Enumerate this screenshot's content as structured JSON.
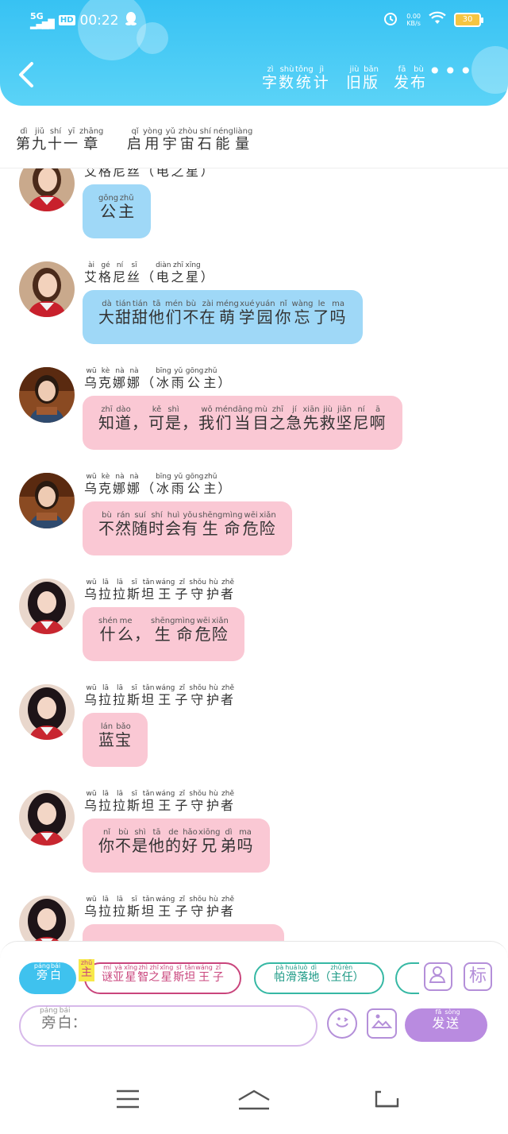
{
  "status_bar": {
    "signal": "5G",
    "hd": "HD",
    "time": "00:22",
    "net_speed_top": "0.00",
    "net_speed_bottom": "KB/s",
    "battery": "30"
  },
  "header": {
    "buttons": [
      {
        "text": "字数统计",
        "pinyin": [
          "zì",
          "shù",
          "tǒng",
          "jì"
        ]
      },
      {
        "text": "旧版",
        "pinyin": [
          "jiù",
          "bǎn"
        ]
      },
      {
        "text": "发布",
        "pinyin": [
          "fā",
          "bù"
        ]
      }
    ],
    "more": "•••"
  },
  "chapter": {
    "text": "第九十一章",
    "pinyin": [
      "dì",
      "jiǔ",
      "shí",
      "yī",
      "zhāng"
    ],
    "title": "启用宇宙石能量",
    "title_pinyin": [
      "qǐ",
      "yòng",
      "yǔ",
      "zhòu",
      "shí",
      "néng",
      "liàng"
    ]
  },
  "messages": [
    {
      "speaker": "艾格尼丝（电之星）",
      "speaker_pinyin": [
        "ài",
        "gé",
        "ní",
        "sī",
        "",
        "diàn",
        "zhī",
        "xīng",
        ""
      ],
      "text": "公主",
      "pinyin": [
        "gōng",
        "zhǔ"
      ],
      "color": "blue",
      "avatar": "agnes"
    },
    {
      "speaker": "艾格尼丝（电之星）",
      "speaker_pinyin": [
        "ài",
        "gé",
        "ní",
        "sī",
        "",
        "diàn",
        "zhī",
        "xīng",
        ""
      ],
      "text": "大甜甜他们不在萌学园你忘了吗",
      "pinyin": [
        "dà",
        "tián",
        "tián",
        "tā",
        "mén",
        "bù",
        "zài",
        "méng",
        "xué",
        "yuán",
        "nǐ",
        "wàng",
        "le",
        "ma"
      ],
      "color": "blue",
      "avatar": "agnes"
    },
    {
      "speaker": "乌克娜娜（冰雨公主）",
      "speaker_pinyin": [
        "wū",
        "kè",
        "nà",
        "nà",
        "",
        "bīng",
        "yǔ",
        "gōng",
        "zhǔ",
        ""
      ],
      "text": "知道，可是，我们当目之急先救坚尼啊",
      "pinyin": [
        "zhī",
        "dào",
        "",
        "kě",
        "shì",
        "",
        "wǒ",
        "mén",
        "dāng",
        "mù",
        "zhī",
        "jí",
        "xiān",
        "jiù",
        "jiān",
        "ní",
        "ā"
      ],
      "color": "pink",
      "avatar": "ukenana"
    },
    {
      "speaker": "乌克娜娜（冰雨公主）",
      "speaker_pinyin": [
        "wū",
        "kè",
        "nà",
        "nà",
        "",
        "bīng",
        "yǔ",
        "gōng",
        "zhǔ",
        ""
      ],
      "text": "不然随时会有生命危险",
      "pinyin": [
        "bù",
        "rán",
        "suí",
        "shí",
        "huì",
        "yǒu",
        "shēng",
        "mìng",
        "wēi",
        "xiǎn"
      ],
      "color": "pink",
      "avatar": "ukenana"
    },
    {
      "speaker": "乌拉拉斯坦王子守护者",
      "speaker_pinyin": [
        "wū",
        "lā",
        "lā",
        "sī",
        "tǎn",
        "wáng",
        "zǐ",
        "shǒu",
        "hù",
        "zhě"
      ],
      "text": "什么，生命危险",
      "pinyin": [
        "shén",
        "me",
        "",
        "shēng",
        "mìng",
        "wēi",
        "xiǎn"
      ],
      "color": "pink",
      "avatar": "urala"
    },
    {
      "speaker": "乌拉拉斯坦王子守护者",
      "speaker_pinyin": [
        "wū",
        "lā",
        "lā",
        "sī",
        "tǎn",
        "wáng",
        "zǐ",
        "shǒu",
        "hù",
        "zhě"
      ],
      "text": "蓝宝",
      "pinyin": [
        "lán",
        "bǎo"
      ],
      "color": "pink",
      "avatar": "urala"
    },
    {
      "speaker": "乌拉拉斯坦王子守护者",
      "speaker_pinyin": [
        "wū",
        "lā",
        "lā",
        "sī",
        "tǎn",
        "wáng",
        "zǐ",
        "shǒu",
        "hù",
        "zhě"
      ],
      "text": "你不是他的好兄弟吗",
      "pinyin": [
        "nǐ",
        "bù",
        "shì",
        "tā",
        "de",
        "hǎo",
        "xiōng",
        "dì",
        "ma"
      ],
      "color": "pink",
      "avatar": "urala"
    },
    {
      "speaker": "乌拉拉斯坦王子守护者",
      "speaker_pinyin": [
        "wū",
        "lā",
        "lā",
        "sī",
        "tǎn",
        "wáng",
        "zǐ",
        "shǒu",
        "hù",
        "zhě"
      ],
      "text": "",
      "pinyin": [],
      "color": "pink",
      "avatar": "urala"
    }
  ],
  "toolbar": {
    "narrator_chip": {
      "text": "旁白",
      "pinyin": [
        "páng",
        "bái"
      ]
    },
    "main_badge": {
      "text": "主",
      "pinyin": [
        "zhǔ"
      ]
    },
    "char_chip_1": {
      "text": "谜亚星智之星斯坦王子",
      "pinyin": [
        "mí",
        "yà",
        "xīng",
        "zhì",
        "zhī",
        "xīng",
        "sī",
        "tǎn",
        "wáng",
        "zǐ"
      ]
    },
    "char_chip_2": {
      "text": "帕滑落地（主任）",
      "pinyin": [
        "pà",
        "huá",
        "luò",
        "dì",
        "",
        "zhǔ",
        "rèn",
        ""
      ]
    },
    "input_placeholder": {
      "text": "旁白：",
      "pinyin": [
        "páng",
        "bái",
        ""
      ]
    },
    "send": {
      "text": "发送",
      "pinyin": [
        "fā",
        "sòng"
      ]
    },
    "mark_icon": "标"
  },
  "colors": {
    "header": "#37c2f3",
    "blue_bubble": "#9fd8f7",
    "pink_bubble": "#fac8d4",
    "purple": "#b98be0",
    "main_char": "#c9457c",
    "teal": "#36b8a4"
  }
}
